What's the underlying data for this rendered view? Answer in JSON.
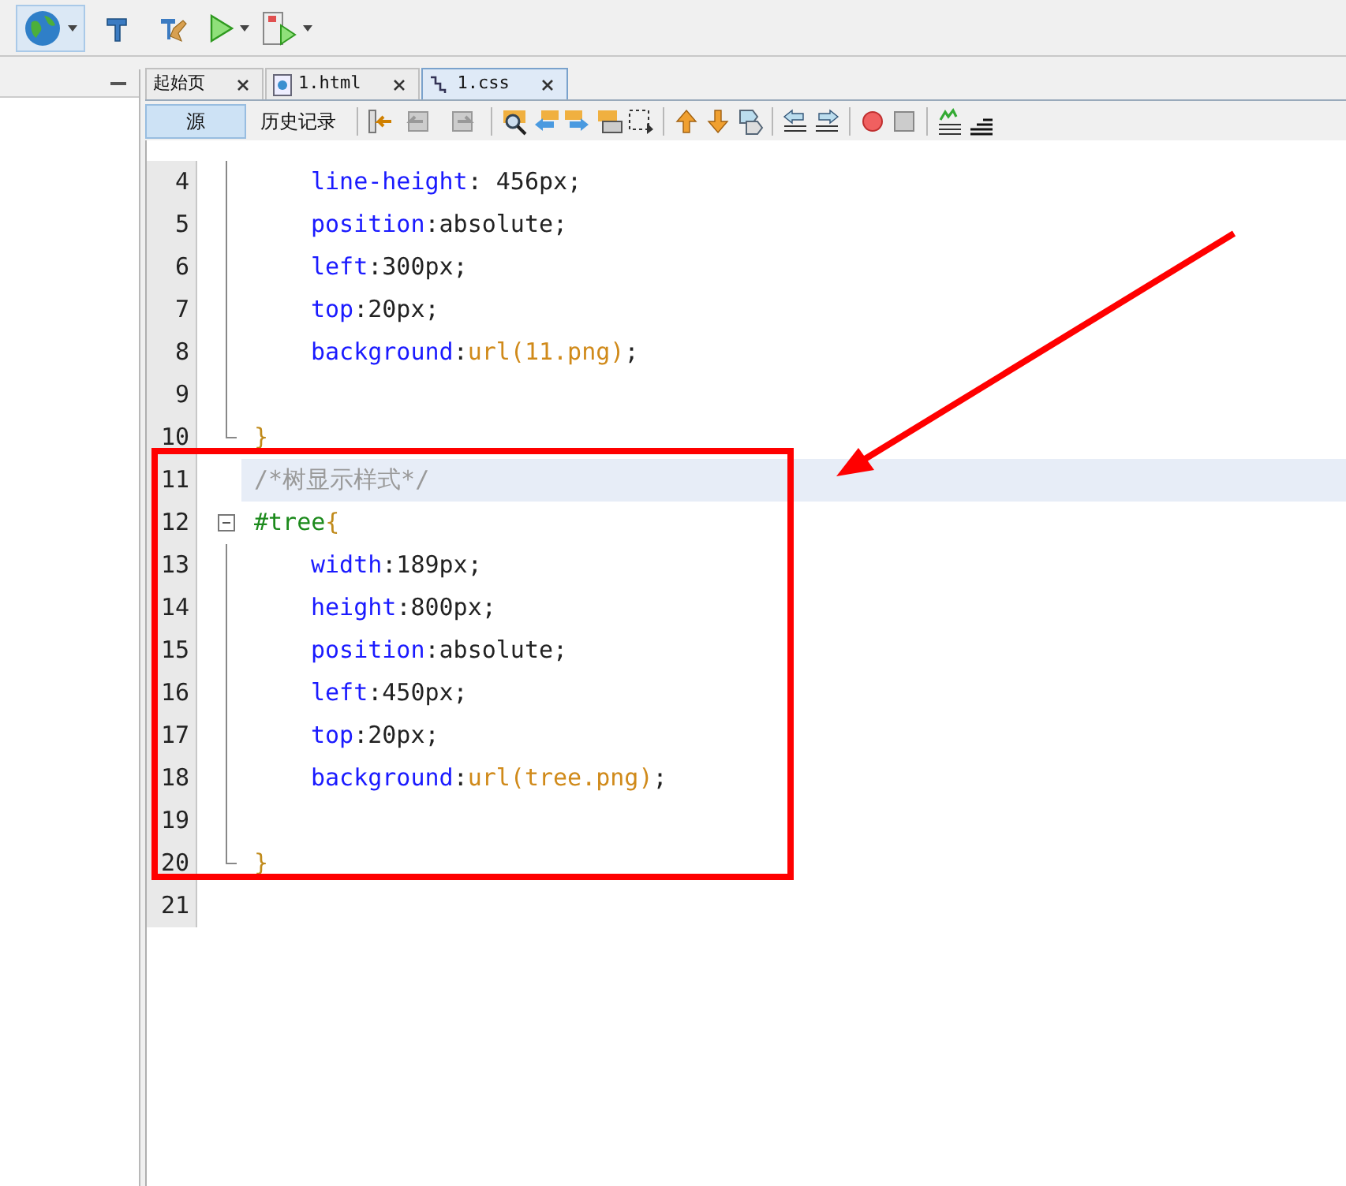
{
  "tabs": [
    {
      "label": "起始页",
      "kind": "plain",
      "selected": false
    },
    {
      "label": "1.html",
      "kind": "html",
      "selected": false
    },
    {
      "label": "1.css",
      "kind": "css",
      "selected": true
    }
  ],
  "views": [
    {
      "label": "源",
      "selected": true
    },
    {
      "label": "历史记录",
      "selected": false
    }
  ],
  "code": [
    {
      "children": [
        {
          "number": "4",
          "highlighted": false,
          "tokens": [
            {
              "kind": "property",
              "text": "line-height"
            },
            {
              "kind": "value",
              "text": ": 456px;"
            }
          ]
        },
        {
          "number": "5",
          "highlighted": false,
          "tokens": [
            {
              "kind": "property",
              "text": "position"
            },
            {
              "kind": "value",
              "text": ":absolute;"
            }
          ]
        },
        {
          "number": "6",
          "highlighted": false,
          "tokens": [
            {
              "kind": "property",
              "text": "left"
            },
            {
              "kind": "value",
              "text": ":300px;"
            }
          ]
        },
        {
          "number": "7",
          "highlighted": false,
          "tokens": [
            {
              "kind": "property",
              "text": "top"
            },
            {
              "kind": "value",
              "text": ":20px;"
            }
          ]
        },
        {
          "number": "8",
          "highlighted": false,
          "tokens": [
            {
              "kind": "property",
              "text": "background"
            },
            {
              "kind": "value",
              "text": ":"
            },
            {
              "kind": "function",
              "text": "url(11.png)"
            },
            {
              "kind": "value",
              "text": ";"
            }
          ]
        },
        {
          "number": "9",
          "highlighted": false
        }
      ],
      "closer": {
        "number": "10",
        "highlighted": false,
        "tokens": [
          {
            "kind": "brace",
            "text": "}"
          }
        ]
      }
    },
    {
      "number": "11",
      "highlighted": true,
      "tokens": [
        {
          "kind": "comment",
          "text": "/*树显示样式*/"
        }
      ]
    },
    {
      "opener": {
        "number": "12",
        "highlighted": false,
        "tokens": [
          {
            "kind": "selector",
            "text": "#tree"
          },
          {
            "kind": "brace",
            "text": "{"
          }
        ]
      },
      "children": [
        {
          "number": "13",
          "highlighted": false,
          "tokens": [
            {
              "kind": "property",
              "text": "width"
            },
            {
              "kind": "value",
              "text": ":189px;"
            }
          ]
        },
        {
          "number": "14",
          "highlighted": false,
          "tokens": [
            {
              "kind": "property",
              "text": "height"
            },
            {
              "kind": "value",
              "text": ":800px;"
            }
          ]
        },
        {
          "number": "15",
          "highlighted": false,
          "tokens": [
            {
              "kind": "property",
              "text": "position"
            },
            {
              "kind": "value",
              "text": ":absolute;"
            }
          ]
        },
        {
          "number": "16",
          "highlighted": false,
          "tokens": [
            {
              "kind": "property",
              "text": "left"
            },
            {
              "kind": "value",
              "text": ":450px;"
            }
          ]
        },
        {
          "number": "17",
          "highlighted": false,
          "tokens": [
            {
              "kind": "property",
              "text": "top"
            },
            {
              "kind": "value",
              "text": ":20px;"
            }
          ]
        },
        {
          "number": "18",
          "highlighted": false,
          "tokens": [
            {
              "kind": "property",
              "text": "background"
            },
            {
              "kind": "value",
              "text": ":"
            },
            {
              "kind": "function",
              "text": "url(tree.png)"
            },
            {
              "kind": "value",
              "text": ";"
            }
          ]
        },
        {
          "number": "19",
          "highlighted": false
        }
      ],
      "closer": {
        "number": "20",
        "highlighted": false,
        "tokens": [
          {
            "kind": "brace",
            "text": "}"
          }
        ]
      }
    },
    {
      "number": "21",
      "highlighted": false
    }
  ]
}
